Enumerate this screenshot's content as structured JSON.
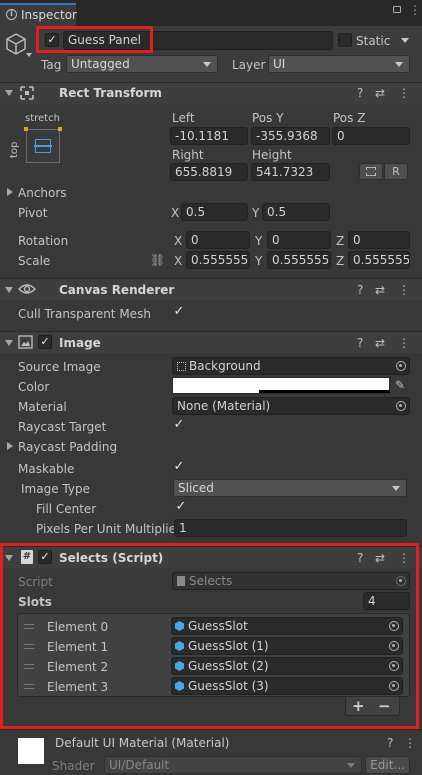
{
  "tab": {
    "title": "Inspector"
  },
  "gameobject": {
    "name": "Guess Panel",
    "static_label": "Static",
    "tag_label": "Tag",
    "tag_value": "Untagged",
    "layer_label": "Layer",
    "layer_value": "UI"
  },
  "rect_transform": {
    "title": "Rect Transform",
    "anchor_preset_top": "stretch",
    "anchor_preset_side": "top",
    "labels": {
      "left": "Left",
      "posy": "Pos Y",
      "posz": "Pos Z",
      "right": "Right",
      "height": "Height"
    },
    "values": {
      "left": "-10.1181",
      "posy": "-355.9368",
      "posz": "0",
      "right": "655.8819",
      "height": "541.7323"
    },
    "r_button": "R",
    "anchors_label": "Anchors",
    "pivot_label": "Pivot",
    "pivot": {
      "x": "0.5",
      "y": "0.5"
    },
    "rotation_label": "Rotation",
    "rotation": {
      "x": "0",
      "y": "0",
      "z": "0"
    },
    "scale_label": "Scale",
    "scale": {
      "x": "0.5555556",
      "y": "0.5555556",
      "z": "0.5555556"
    },
    "axis": {
      "x": "X",
      "y": "Y",
      "z": "Z"
    }
  },
  "canvas_renderer": {
    "title": "Canvas Renderer",
    "cull_label": "Cull Transparent Mesh"
  },
  "image": {
    "title": "Image",
    "source_label": "Source Image",
    "source_value": "Background",
    "color_label": "Color",
    "material_label": "Material",
    "material_value": "None (Material)",
    "raycast_target_label": "Raycast Target",
    "raycast_padding_label": "Raycast Padding",
    "maskable_label": "Maskable",
    "image_type_label": "Image Type",
    "image_type_value": "Sliced",
    "fill_center_label": "Fill Center",
    "ppu_label": "Pixels Per Unit Multiplier",
    "ppu_value": "1"
  },
  "selects": {
    "title": "Selects (Script)",
    "script_label": "Script",
    "script_value": "Selects",
    "slots_label": "Slots",
    "slots_count": "4",
    "elements": [
      {
        "label": "Element 0",
        "value": "GuessSlot"
      },
      {
        "label": "Element 1",
        "value": "GuessSlot (1)"
      },
      {
        "label": "Element 2",
        "value": "GuessSlot (2)"
      },
      {
        "label": "Element 3",
        "value": "GuessSlot (3)"
      }
    ],
    "add_label": "+",
    "remove_label": "−"
  },
  "material_footer": {
    "title": "Default UI Material (Material)",
    "shader_label": "Shader",
    "shader_value": "UI/Default",
    "edit_label": "Edit..."
  },
  "colors": {
    "panel": "#383838",
    "highlight_red": "#e0201f",
    "prefab_blue": "#4aa8e0"
  }
}
